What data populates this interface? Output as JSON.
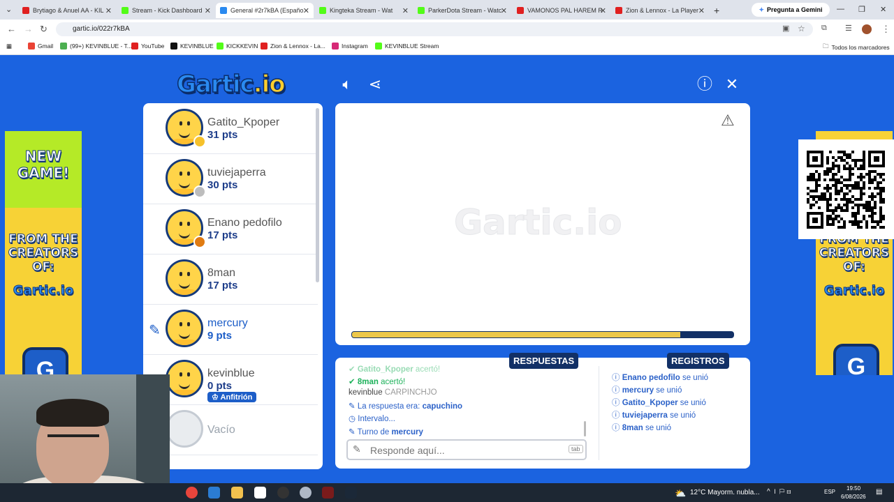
{
  "browser": {
    "tabs": [
      {
        "title": "Brytiago & Anuel AA - KIL",
        "color": "#e02020"
      },
      {
        "title": "Stream - Kick Dashboard",
        "color": "#53fc18"
      },
      {
        "title": "General #2r7kBA (Españo",
        "color": "#2a8af0"
      },
      {
        "title": "Kingteka Stream - Wat",
        "color": "#53fc18"
      },
      {
        "title": "ParkerDota Stream - Watc",
        "color": "#53fc18"
      },
      {
        "title": "VAMONOS PAL HAREM R",
        "color": "#e02020"
      },
      {
        "title": "Zion & Lennox - La Player",
        "color": "#e02020"
      }
    ],
    "new_tab": "+",
    "gemini": "Pregunta a Gemini",
    "url": "gartic.io/022r7kBA",
    "bookmarks": [
      {
        "label": "Gmail",
        "color": "#ea4335"
      },
      {
        "label": "(99+) KEVINBLUE - T...",
        "color": "#4caf50"
      },
      {
        "label": "YouTube",
        "color": "#e02020"
      },
      {
        "label": "KEVINBLUE",
        "color": "#111111"
      },
      {
        "label": "KICKKEVIN",
        "color": "#53fc18"
      },
      {
        "label": "Zion & Lennox - La...",
        "color": "#e02020"
      },
      {
        "label": "Instagram",
        "color": "#d62976"
      },
      {
        "label": "KEVINBLUE Stream",
        "color": "#53fc18"
      }
    ],
    "all_bookmarks": "Todos los marcadores"
  },
  "game": {
    "logo": "Gartic",
    "logo_io": ".io",
    "watermark": "Gartic.io",
    "players": [
      {
        "name": "Gatito_Kpoper",
        "pts": "31 pts",
        "badge": "#f6c12b"
      },
      {
        "name": "tuviejaperra",
        "pts": "30 pts",
        "badge": "#bdbdbd"
      },
      {
        "name": "Enano pedofilo",
        "pts": "17 pts",
        "badge": "#e07b12"
      },
      {
        "name": "8man",
        "pts": "17 pts",
        "badge": ""
      },
      {
        "name": "mercury",
        "pts": "9 pts",
        "badge": ""
      },
      {
        "name": "kevinblue",
        "pts": "0 pts",
        "badge": ""
      },
      {
        "name": "Vacío",
        "pts": "",
        "badge": ""
      }
    ],
    "host_label": "Anfitrión",
    "timer_progress": 0.86,
    "tabs": {
      "answers": "RESPUESTAS",
      "logs": "REGISTROS"
    },
    "chat": {
      "line1_user": "Gatito_Kpoper",
      "line1_text": "acertó!",
      "line2_user": "8man",
      "line2_text": "acertó!",
      "line3_user": "kevinblue",
      "line3_text": "CARPINCHJO",
      "line4_text": "La respuesta era:",
      "line4_value": "capuchino",
      "line5_text": "Intervalo...",
      "line6_text": "Turno de",
      "line6_value": "mercury"
    },
    "logs": [
      {
        "user": "Enano pedofilo",
        "text": "se unió"
      },
      {
        "user": "mercury",
        "text": "se unió"
      },
      {
        "user": "Gatito_Kpoper",
        "text": "se unió"
      },
      {
        "user": "tuviejaperra",
        "text": "se unió"
      },
      {
        "user": "8man",
        "text": "se unió"
      }
    ],
    "input_placeholder": "Responde aquí...",
    "tab_hint": "tab"
  },
  "ads": {
    "new_game": "NEW GAME!",
    "from_creators": "FROM THE CREATORS OF:",
    "mini_logo": "Gartic.io",
    "g": "G"
  },
  "taskbar": {
    "weather": "12°C  Mayorm. nubla...",
    "lang": "ESP",
    "time": "19:50",
    "date": "6/08/2026"
  }
}
